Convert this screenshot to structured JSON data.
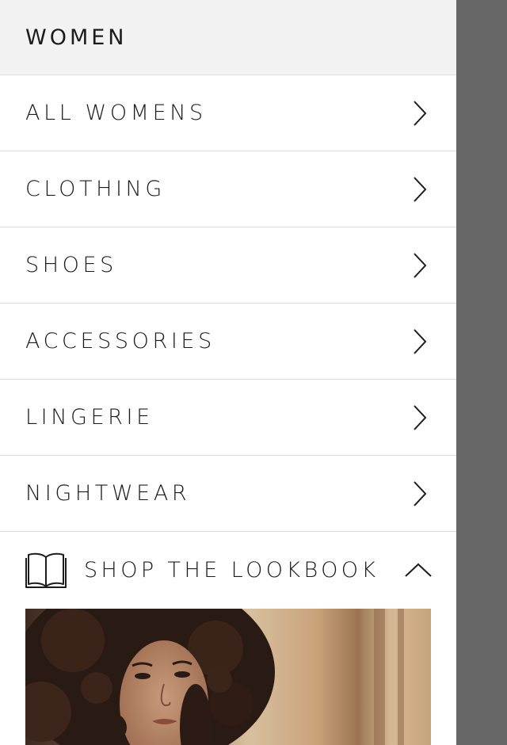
{
  "header": {
    "title": "WOMEN"
  },
  "menu": {
    "items": [
      {
        "label": "ALL WOMENS"
      },
      {
        "label": "CLOTHING"
      },
      {
        "label": "SHOES"
      },
      {
        "label": "ACCESSORIES"
      },
      {
        "label": "LINGERIE"
      },
      {
        "label": "NIGHTWEAR"
      }
    ]
  },
  "lookbook": {
    "label": "SHOP THE LOOKBOOK",
    "icon": "book-icon",
    "toggle_icon": "chevron-up-icon",
    "image_alt": "woman with curly hair"
  },
  "colors": {
    "overlay": "#676767",
    "header_bg": "#f2f2f2",
    "divider": "#dcdcdc",
    "text": "#1c1c1c"
  }
}
